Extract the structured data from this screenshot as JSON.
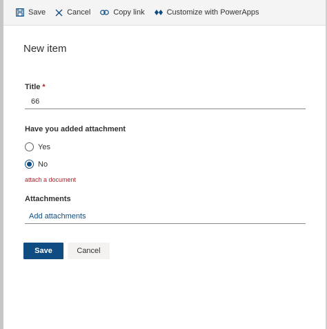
{
  "toolbar": {
    "save_label": "Save",
    "cancel_label": "Cancel",
    "copy_link_label": "Copy link",
    "customize_label": "Customize with PowerApps"
  },
  "form": {
    "heading": "New item",
    "title_field": {
      "label": "Title",
      "required_marker": "*",
      "value": "66"
    },
    "attachment_question": {
      "label": "Have you added attachment",
      "options": [
        {
          "label": "Yes",
          "selected": false
        },
        {
          "label": "No",
          "selected": true
        }
      ],
      "error": "attach a document"
    },
    "attachments": {
      "label": "Attachments",
      "add_label": "Add attachments"
    },
    "actions": {
      "save_label": "Save",
      "cancel_label": "Cancel"
    }
  },
  "colors": {
    "accent": "#0f4c81",
    "error": "#a4262c",
    "command_bar_bg": "#f4f4f4"
  }
}
